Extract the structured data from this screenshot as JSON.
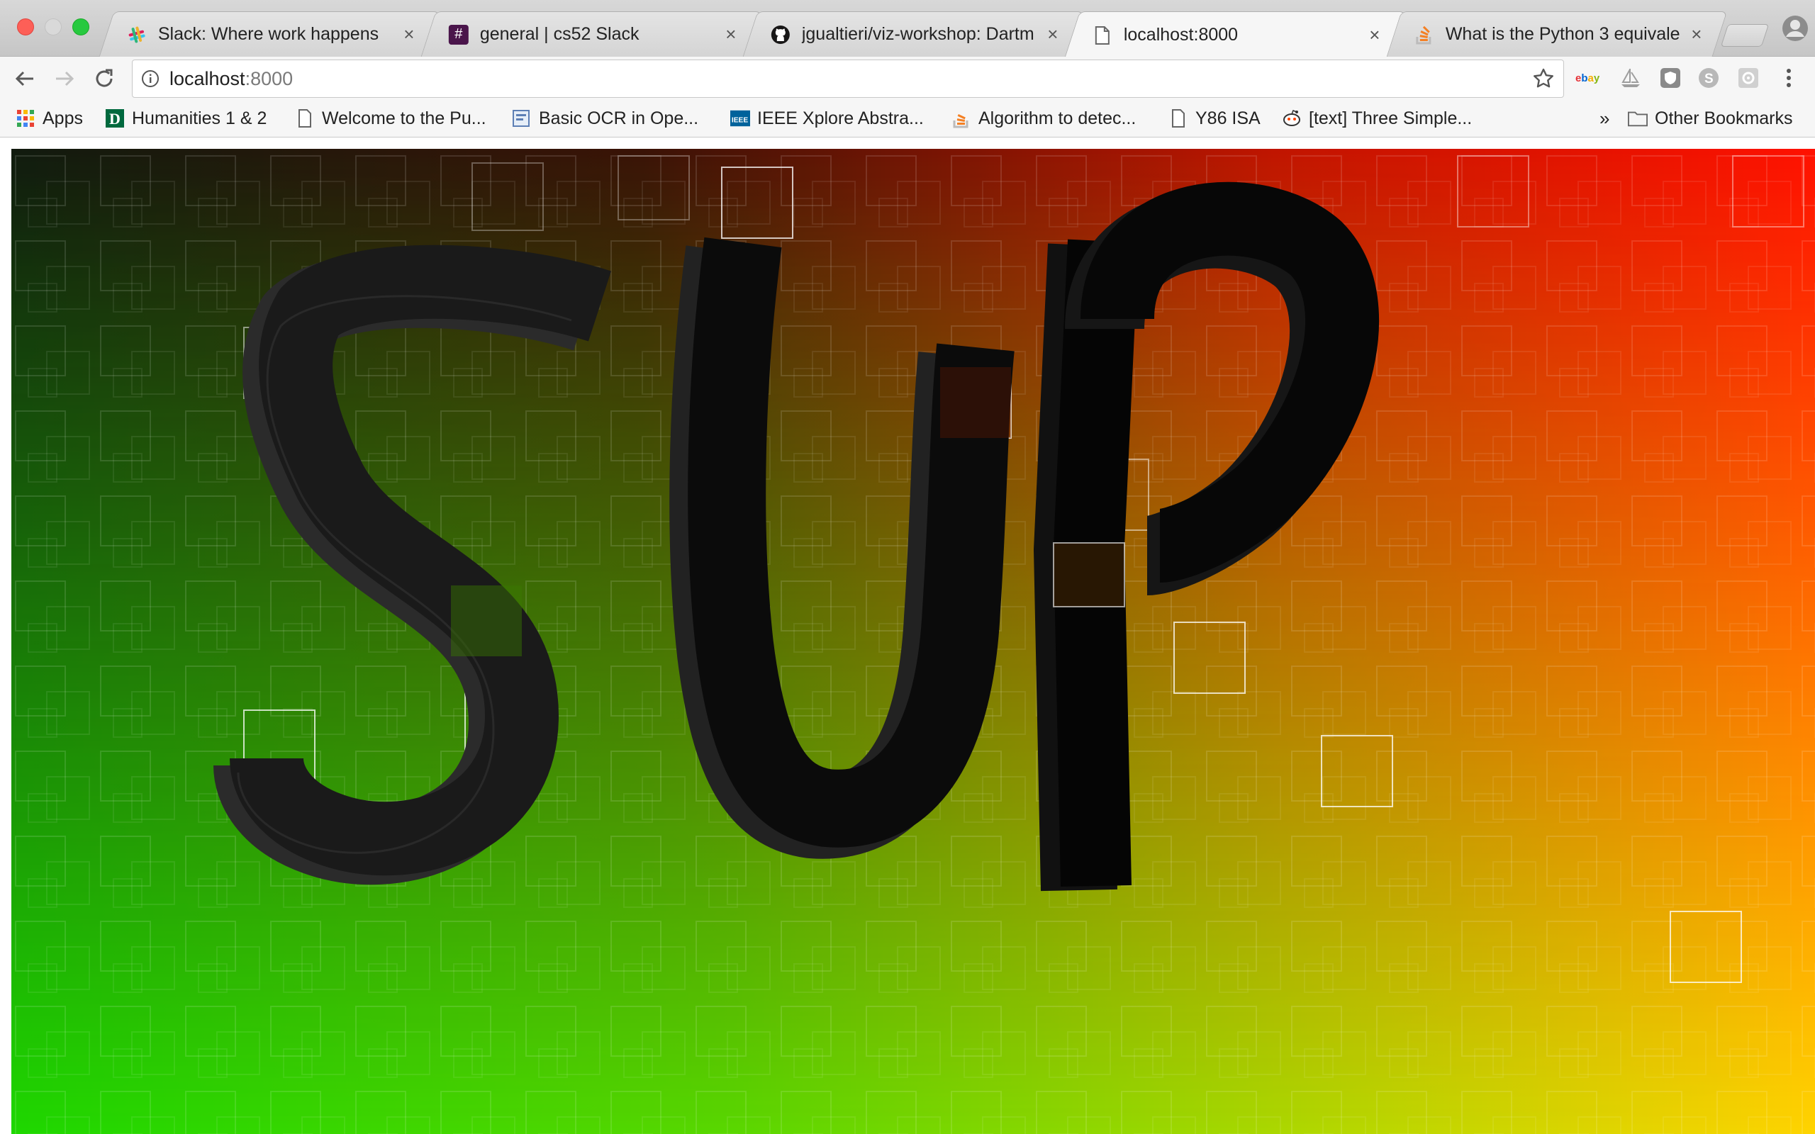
{
  "window": {
    "tabs": [
      {
        "title": "Slack: Where work happens",
        "favicon": "slack-logo-icon",
        "active": false
      },
      {
        "title": "general | cs52 Slack",
        "favicon": "hash-icon",
        "active": false
      },
      {
        "title": "jgualtieri/viz-workshop: Dartm",
        "favicon": "github-icon",
        "active": false
      },
      {
        "title": "localhost:8000",
        "favicon": "page-icon",
        "active": true
      },
      {
        "title": "What is the Python 3 equivale",
        "favicon": "stackoverflow-icon",
        "active": false
      }
    ],
    "close_glyph": "×"
  },
  "toolbar": {
    "url_host": "localhost",
    "url_port": ":8000"
  },
  "extensions": [
    "ebay-icon",
    "sailboat-icon",
    "shield-extension-icon",
    "skype-icon",
    "settings-extension-icon",
    "menu-dots-icon"
  ],
  "extension_ebay_label": "ebay",
  "bookmarks": {
    "items": [
      {
        "label": "Apps",
        "icon": "apps-grid-icon"
      },
      {
        "label": "Humanities 1 & 2",
        "icon": "dartmouth-d-icon"
      },
      {
        "label": "Welcome to the Pu...",
        "icon": "page-icon"
      },
      {
        "label": "Basic OCR in Ope...",
        "icon": "blue-page-icon"
      },
      {
        "label": "IEEE Xplore Abstra...",
        "icon": "ieee-icon"
      },
      {
        "label": "Algorithm to detec...",
        "icon": "stackoverflow-icon"
      },
      {
        "label": "Y86 ISA",
        "icon": "page-icon"
      },
      {
        "label": "[text] Three Simple...",
        "icon": "reddit-icon"
      }
    ],
    "overflow": "»",
    "other": "Other Bookmarks"
  },
  "canvas": {
    "description_icon": "generative-art-canvas",
    "gradient_colors": {
      "top_left": "#1a1a1a",
      "top_right": "#ff0000",
      "bottom_left": "#22ee00",
      "bottom_right": "#ffdd00"
    },
    "drawn_text": "SUP",
    "stroke_color": "#111111"
  }
}
